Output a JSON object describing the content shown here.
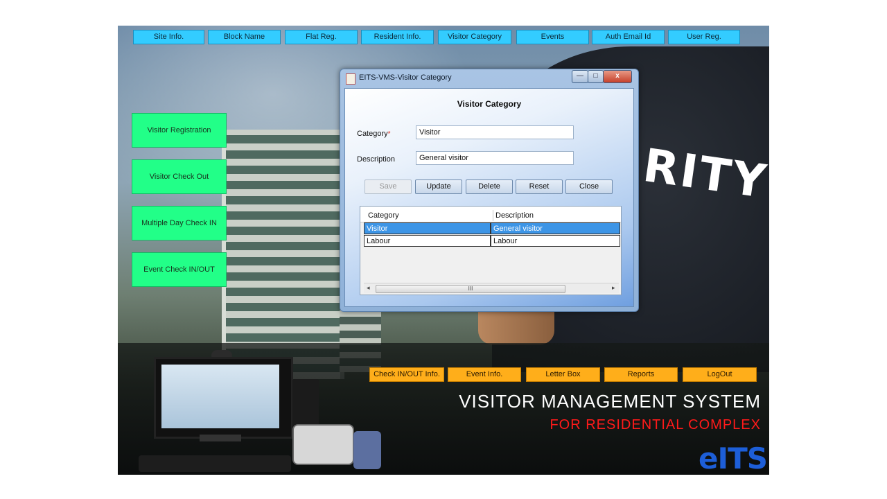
{
  "top_nav": [
    {
      "label": "Site Info."
    },
    {
      "label": "Block Name"
    },
    {
      "label": "Flat Reg."
    },
    {
      "label": "Resident Info."
    },
    {
      "label": "Visitor Category"
    },
    {
      "label": "Events"
    },
    {
      "label": "Auth Email Id"
    },
    {
      "label": "User Reg."
    }
  ],
  "side_menu": [
    {
      "label": "Visitor Registration"
    },
    {
      "label": "Visitor Check Out"
    },
    {
      "label": "Multiple Day Check IN"
    },
    {
      "label": "Event Check IN/OUT"
    }
  ],
  "bottom_nav": [
    {
      "label": "Check IN/OUT Info."
    },
    {
      "label": "Event Info."
    },
    {
      "label": "Letter Box"
    },
    {
      "label": "Reports"
    },
    {
      "label": "LogOut"
    }
  ],
  "branding": {
    "title": "VISITOR MANAGEMENT SYSTEM",
    "subtitle": "FOR RESIDENTIAL COMPLEX",
    "logo": "eITS",
    "background_word": "RITY"
  },
  "dialog": {
    "window_title": "EITS-VMS-Visitor Category",
    "heading": "Visitor Category",
    "category_label": "Category",
    "required_mark": "*",
    "category_value": "Visitor",
    "description_label": "Description",
    "description_value": "General visitor",
    "buttons": {
      "save": "Save",
      "update": "Update",
      "delete": "Delete",
      "reset": "Reset",
      "close": "Close"
    },
    "window_buttons": {
      "minimize": "—",
      "maximize": "□",
      "close": "x"
    },
    "grid": {
      "columns": [
        "Category",
        "Description"
      ],
      "rows": [
        {
          "category": "Visitor",
          "description": "General visitor",
          "selected": true
        },
        {
          "category": "Labour",
          "description": "Labour",
          "selected": false
        }
      ],
      "scroll_thumb": "III",
      "scroll_left": "◂",
      "scroll_right": "▸"
    }
  },
  "colors": {
    "top_nav": "#33ccff",
    "side_menu": "#22ff88",
    "bottom_nav": "#ffae1a",
    "subtitle": "#ff1a1a",
    "selection": "#3d95e6"
  }
}
